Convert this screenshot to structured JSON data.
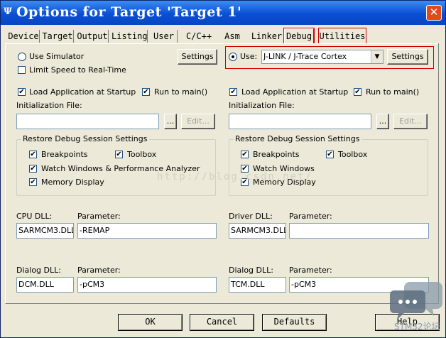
{
  "window": {
    "icon_glyph": "Ψ",
    "title": "Options for Target 'Target 1'",
    "close_glyph": "✕"
  },
  "tabs": [
    {
      "label": "Device"
    },
    {
      "label": "Target"
    },
    {
      "label": "Output"
    },
    {
      "label": "Listing"
    },
    {
      "label": "User"
    },
    {
      "label": "C/C++"
    },
    {
      "label": "Asm"
    },
    {
      "label": "Linker"
    },
    {
      "label": "Debug",
      "active": true
    },
    {
      "label": "Utilities"
    }
  ],
  "left": {
    "use_simulator": "Use Simulator",
    "limit_speed": "Limit Speed to Real-Time",
    "settings_button": "Settings",
    "load_app": "Load Application at Startup",
    "run_to_main": "Run to main()",
    "init_file_label": "Initialization File:",
    "init_file_value": "",
    "browse_button": "...",
    "edit_button": "Edit...",
    "restore_group": "Restore Debug Session Settings",
    "breakpoints": "Breakpoints",
    "toolbox": "Toolbox",
    "watch_windows": "Watch Windows & Performance Analyzer",
    "memory_display": "Memory Display",
    "cpu_dll_label": "CPU DLL:",
    "cpu_dll_value": "SARMCM3.DLL",
    "cpu_param_label": "Parameter:",
    "cpu_param_value": "-REMAP",
    "dialog_dll_label": "Dialog DLL:",
    "dialog_dll_value": "DCM.DLL",
    "dialog_param_label": "Parameter:",
    "dialog_param_value": "-pCM3"
  },
  "right": {
    "use_label": "Use:",
    "debugger_selected": "J-LINK / J-Trace Cortex",
    "settings_button": "Settings",
    "load_app": "Load Application at Startup",
    "run_to_main": "Run to main()",
    "init_file_label": "Initialization File:",
    "init_file_value": "",
    "browse_button": "...",
    "edit_button": "Edit...",
    "restore_group": "Restore Debug Session Settings",
    "breakpoints": "Breakpoints",
    "toolbox": "Toolbox",
    "watch_windows": "Watch Windows",
    "memory_display": "Memory Display",
    "driver_dll_label": "Driver DLL:",
    "driver_dll_value": "SARMCM3.DLL",
    "driver_param_label": "Parameter:",
    "driver_param_value": "",
    "dialog_dll_label": "Dialog DLL:",
    "dialog_dll_value": "TCM.DLL",
    "dialog_param_label": "Parameter:",
    "dialog_param_value": "-pCM3"
  },
  "checks": {
    "left_use_simulator": false,
    "left_limit_speed": false,
    "left_load_app": true,
    "left_run_to_main": true,
    "left_breakpoints": true,
    "left_toolbox": true,
    "left_watch": true,
    "left_memory": true,
    "right_use": true,
    "right_load_app": true,
    "right_run_to_main": true,
    "right_breakpoints": true,
    "right_toolbox": true,
    "right_watch": true,
    "right_memory": true
  },
  "check_glyph": "✔",
  "footer": {
    "ok": "OK",
    "cancel": "Cancel",
    "defaults": "Defaults",
    "help": "Help"
  },
  "watermark": {
    "url_text": "http://blog.csdn.net/",
    "logo_text": "STM32论坛"
  },
  "colors": {
    "titlebar": "#0a4fd4",
    "dialog_bg": "#ece9d8",
    "highlight_red": "#d00000",
    "close_button": "#e14a1f"
  }
}
